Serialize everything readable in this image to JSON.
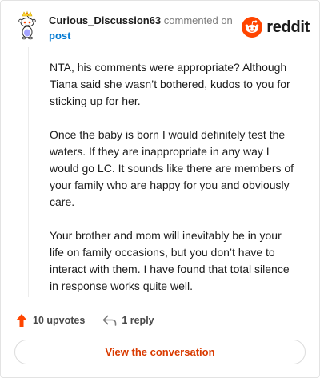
{
  "header": {
    "username": "Curious_Discussion63",
    "commented_on": "commented on",
    "post_link": "post",
    "brand": "reddit"
  },
  "comment": {
    "paragraphs": [
      "NTA, his comments were appropriate? Although Tiana said she wasn’t bothered, kudos to you for sticking up for her.",
      "Once the baby is born I would definitely test the waters. If they are inappropriate in any way I would go LC. It sounds like there are members of your family who are happy for you and obviously care.",
      "Your brother and mom will inevitably be in your life on family occasions, but you don’t have to interact with them. I have found that total silence in response works quite well."
    ]
  },
  "actions": {
    "upvotes": "10 upvotes",
    "replies": "1 reply"
  },
  "cta": {
    "label": "View the conversation"
  },
  "colors": {
    "brand_orange": "#ff4500",
    "link_blue": "#0079d3",
    "cta_text": "#d93a00"
  }
}
